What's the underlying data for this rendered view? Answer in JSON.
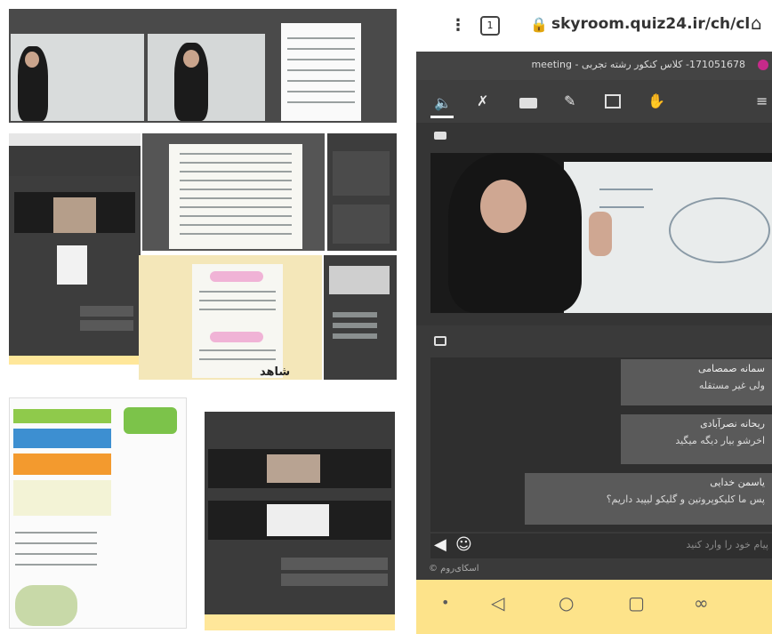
{
  "browser": {
    "url": "skyroom.quiz24.ir/ch/cl",
    "tab_count": "1"
  },
  "meeting": {
    "title": "171051678- کلاس کنکور رشته تجربی - meeting"
  },
  "toolbar": {
    "icons": [
      "speaker-icon",
      "mic-muted-icon",
      "camera-icon",
      "pen-icon",
      "screen-share-icon",
      "raise-hand-icon",
      "menu-icon"
    ]
  },
  "chat": {
    "messages": [
      {
        "name": "سمانه صمصامی",
        "text": "ولی غیر مستقله"
      },
      {
        "name": "ریحانه نصرآبادی",
        "text": "اخرشو بیار دیگه میگید"
      },
      {
        "name": "یاسمن خدایی",
        "text": "پس ما کلیکوپروتین و گلیکو لیپید داریم؟"
      }
    ],
    "input_placeholder": "پیام خود را وارد کنید",
    "footer": "اسکای‌روم ©"
  },
  "nav": {
    "buttons": [
      "dot-icon",
      "back-icon",
      "home-icon",
      "recents-icon",
      "link-icon"
    ]
  },
  "thumbnail_caption": "شاهد"
}
